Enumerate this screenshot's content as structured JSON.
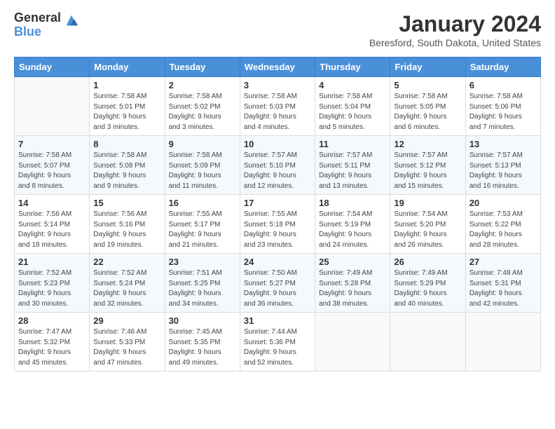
{
  "logo": {
    "general": "General",
    "blue": "Blue"
  },
  "title": "January 2024",
  "location": "Beresford, South Dakota, United States",
  "days_of_week": [
    "Sunday",
    "Monday",
    "Tuesday",
    "Wednesday",
    "Thursday",
    "Friday",
    "Saturday"
  ],
  "weeks": [
    [
      {
        "day": "",
        "info": ""
      },
      {
        "day": "1",
        "info": "Sunrise: 7:58 AM\nSunset: 5:01 PM\nDaylight: 9 hours\nand 3 minutes."
      },
      {
        "day": "2",
        "info": "Sunrise: 7:58 AM\nSunset: 5:02 PM\nDaylight: 9 hours\nand 3 minutes."
      },
      {
        "day": "3",
        "info": "Sunrise: 7:58 AM\nSunset: 5:03 PM\nDaylight: 9 hours\nand 4 minutes."
      },
      {
        "day": "4",
        "info": "Sunrise: 7:58 AM\nSunset: 5:04 PM\nDaylight: 9 hours\nand 5 minutes."
      },
      {
        "day": "5",
        "info": "Sunrise: 7:58 AM\nSunset: 5:05 PM\nDaylight: 9 hours\nand 6 minutes."
      },
      {
        "day": "6",
        "info": "Sunrise: 7:58 AM\nSunset: 5:06 PM\nDaylight: 9 hours\nand 7 minutes."
      }
    ],
    [
      {
        "day": "7",
        "info": "Sunrise: 7:58 AM\nSunset: 5:07 PM\nDaylight: 9 hours\nand 8 minutes."
      },
      {
        "day": "8",
        "info": "Sunrise: 7:58 AM\nSunset: 5:08 PM\nDaylight: 9 hours\nand 9 minutes."
      },
      {
        "day": "9",
        "info": "Sunrise: 7:58 AM\nSunset: 5:09 PM\nDaylight: 9 hours\nand 11 minutes."
      },
      {
        "day": "10",
        "info": "Sunrise: 7:57 AM\nSunset: 5:10 PM\nDaylight: 9 hours\nand 12 minutes."
      },
      {
        "day": "11",
        "info": "Sunrise: 7:57 AM\nSunset: 5:11 PM\nDaylight: 9 hours\nand 13 minutes."
      },
      {
        "day": "12",
        "info": "Sunrise: 7:57 AM\nSunset: 5:12 PM\nDaylight: 9 hours\nand 15 minutes."
      },
      {
        "day": "13",
        "info": "Sunrise: 7:57 AM\nSunset: 5:13 PM\nDaylight: 9 hours\nand 16 minutes."
      }
    ],
    [
      {
        "day": "14",
        "info": "Sunrise: 7:56 AM\nSunset: 5:14 PM\nDaylight: 9 hours\nand 18 minutes."
      },
      {
        "day": "15",
        "info": "Sunrise: 7:56 AM\nSunset: 5:16 PM\nDaylight: 9 hours\nand 19 minutes."
      },
      {
        "day": "16",
        "info": "Sunrise: 7:55 AM\nSunset: 5:17 PM\nDaylight: 9 hours\nand 21 minutes."
      },
      {
        "day": "17",
        "info": "Sunrise: 7:55 AM\nSunset: 5:18 PM\nDaylight: 9 hours\nand 23 minutes."
      },
      {
        "day": "18",
        "info": "Sunrise: 7:54 AM\nSunset: 5:19 PM\nDaylight: 9 hours\nand 24 minutes."
      },
      {
        "day": "19",
        "info": "Sunrise: 7:54 AM\nSunset: 5:20 PM\nDaylight: 9 hours\nand 26 minutes."
      },
      {
        "day": "20",
        "info": "Sunrise: 7:53 AM\nSunset: 5:22 PM\nDaylight: 9 hours\nand 28 minutes."
      }
    ],
    [
      {
        "day": "21",
        "info": "Sunrise: 7:52 AM\nSunset: 5:23 PM\nDaylight: 9 hours\nand 30 minutes."
      },
      {
        "day": "22",
        "info": "Sunrise: 7:52 AM\nSunset: 5:24 PM\nDaylight: 9 hours\nand 32 minutes."
      },
      {
        "day": "23",
        "info": "Sunrise: 7:51 AM\nSunset: 5:25 PM\nDaylight: 9 hours\nand 34 minutes."
      },
      {
        "day": "24",
        "info": "Sunrise: 7:50 AM\nSunset: 5:27 PM\nDaylight: 9 hours\nand 36 minutes."
      },
      {
        "day": "25",
        "info": "Sunrise: 7:49 AM\nSunset: 5:28 PM\nDaylight: 9 hours\nand 38 minutes."
      },
      {
        "day": "26",
        "info": "Sunrise: 7:49 AM\nSunset: 5:29 PM\nDaylight: 9 hours\nand 40 minutes."
      },
      {
        "day": "27",
        "info": "Sunrise: 7:48 AM\nSunset: 5:31 PM\nDaylight: 9 hours\nand 42 minutes."
      }
    ],
    [
      {
        "day": "28",
        "info": "Sunrise: 7:47 AM\nSunset: 5:32 PM\nDaylight: 9 hours\nand 45 minutes."
      },
      {
        "day": "29",
        "info": "Sunrise: 7:46 AM\nSunset: 5:33 PM\nDaylight: 9 hours\nand 47 minutes."
      },
      {
        "day": "30",
        "info": "Sunrise: 7:45 AM\nSunset: 5:35 PM\nDaylight: 9 hours\nand 49 minutes."
      },
      {
        "day": "31",
        "info": "Sunrise: 7:44 AM\nSunset: 5:36 PM\nDaylight: 9 hours\nand 52 minutes."
      },
      {
        "day": "",
        "info": ""
      },
      {
        "day": "",
        "info": ""
      },
      {
        "day": "",
        "info": ""
      }
    ]
  ]
}
